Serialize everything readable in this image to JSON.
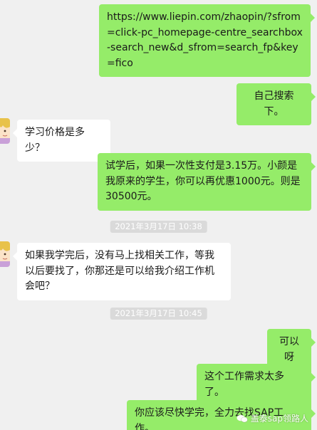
{
  "messages": [
    {
      "id": "m1",
      "from": "me",
      "text": "https://www.liepin.com/zhaopin/?sfrom=click-pc_homepage-centre_searchbox-search_new&d_sfrom=search_fp&key=fico"
    },
    {
      "id": "m2",
      "from": "me",
      "text": "自己搜索下。"
    },
    {
      "id": "m3",
      "from": "other",
      "text": "学习价格是多少？"
    },
    {
      "id": "m4",
      "from": "me",
      "text": "试学后，如果一次性支付是3.15万。小颜是我原来的学生，你可以再优惠1000元。则是30500元。"
    },
    {
      "id": "m5",
      "from": "other",
      "text": "如果我学完后，没有马上找相关工作，等我以后要找了，你那还是可以给我介绍工作机会吧？"
    },
    {
      "id": "m6",
      "from": "me",
      "text": "可以呀"
    },
    {
      "id": "m7",
      "from": "me",
      "text": "这个工作需求太多了。"
    },
    {
      "id": "m8",
      "from": "me",
      "text": "你应该尽快学完，全力去找SAP工作。"
    }
  ],
  "timestamps": [
    "2021年3月17日  10:38",
    "2021年3月17日  10:45"
  ],
  "watermark": "盖泰sap领路人",
  "colors": {
    "background": "#f0f0f0",
    "outgoing": "#95ec69",
    "incoming": "#ffffff",
    "timestamp_bg": "#dadada"
  }
}
